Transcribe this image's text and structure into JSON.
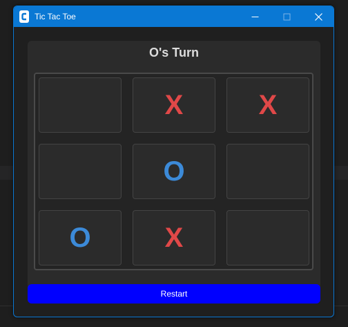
{
  "window": {
    "title": "Tic Tac Toe",
    "accent_color": "#0a78d4",
    "icon": "app-icon",
    "controls": [
      "minimize-icon",
      "maximize-icon",
      "close-icon"
    ]
  },
  "game": {
    "status": "O's Turn",
    "board": [
      [
        "",
        "X",
        "X"
      ],
      [
        "",
        "O",
        ""
      ],
      [
        "O",
        "X",
        ""
      ]
    ],
    "x_color": "#e04848",
    "o_color": "#3c8ad8"
  },
  "restart_button": {
    "label": "Restart",
    "color": "#0000ff"
  }
}
